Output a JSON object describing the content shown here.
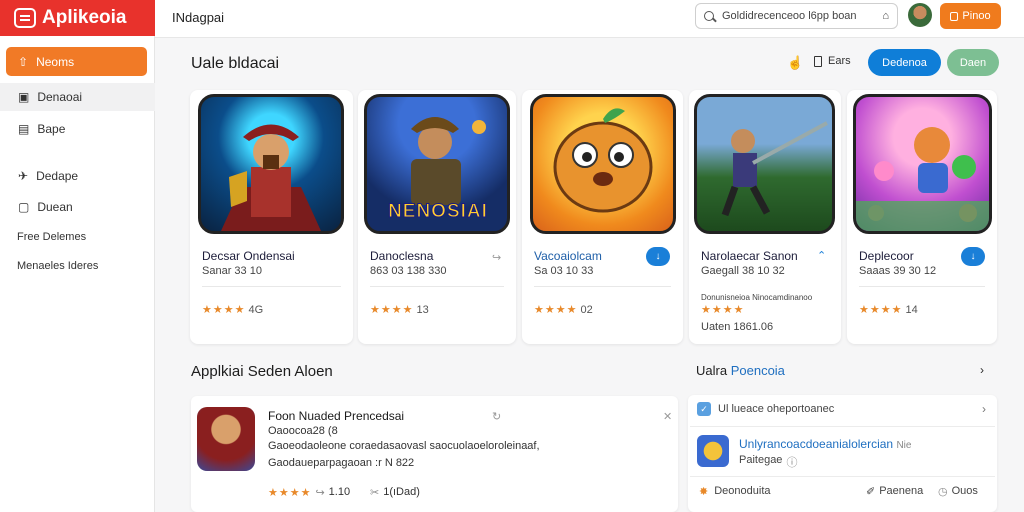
{
  "app": {
    "logo_text": "Aplikeoia"
  },
  "header": {
    "breadcrumb": "INdagpai",
    "search_placeholder": "Goldidrecenceoo l6pp boan",
    "action_label": "Pinoo"
  },
  "sidebar": {
    "items": [
      {
        "label": "Neoms",
        "icon": "⇧"
      },
      {
        "label": "Denaoai",
        "icon": "▣"
      },
      {
        "label": "Bape",
        "icon": "▤"
      },
      {
        "label": "Dedape",
        "icon": "✈"
      },
      {
        "label": "Duean",
        "icon": "▢"
      }
    ],
    "links": [
      "Free Delemes",
      "Menaeles Ideres"
    ]
  },
  "section": {
    "title": "Uale bldacai",
    "filter_label": "Ears",
    "primary_button": "Dedenoa",
    "secondary_button": "Daen"
  },
  "games": [
    {
      "title": "Decsar Ondensai",
      "subtitle": "Sanar 33 10",
      "rating": "4G",
      "stars": "★★★★"
    },
    {
      "title": "Danoclesna",
      "subtitle": "863 03 138 330",
      "rating": "13",
      "stars": "★★★★"
    },
    {
      "title": "Vacoaiolcam",
      "subtitle": "Sa 03 10 33",
      "rating": "02",
      "stars": "★★★★"
    },
    {
      "title": "Narolaecar Sanon",
      "subtitle": "Gaegall 38 10 32",
      "rating": "",
      "stars": "★★★★",
      "extra1": "Donunisneioa Ninocamdinanoo",
      "extra2": "Uaten 1861.06"
    },
    {
      "title": "Deplecoor",
      "subtitle": "Saaas 39 30 12",
      "rating": "14",
      "stars": "★★★★"
    }
  ],
  "game_art_banner": "NENOSIAI",
  "lower": {
    "title": "Applkiai Seden Aloen",
    "app_title": "Foon Nuaded Prencedsai",
    "meta": "Oaoocoa28 (8",
    "desc1": "Gaoeodaoleone coraedasaovasl saocuolaoeloroleinaaf,",
    "desc2": "Gaodaueparpagaoan :r N 822",
    "rating": "1.10",
    "stars": "★★★★",
    "downloads": "1(ıDad)"
  },
  "right_panel": {
    "title_black": "Ualra",
    "title_blue": "Poencoia",
    "row1": "Ul   lueace oheportoanec",
    "row2_title": "Unlyrancoacdoeanialolercian",
    "row2_tag": "Nie",
    "row2_sub": "Paitegae",
    "footer_left": "Deonoduita",
    "footer_mid": "Paenena",
    "footer_right": "Ouos"
  },
  "colors": {
    "brand": "#e8322c",
    "accent": "#f07b1d",
    "primary": "#0f7ed8",
    "green": "#7dbf93"
  }
}
